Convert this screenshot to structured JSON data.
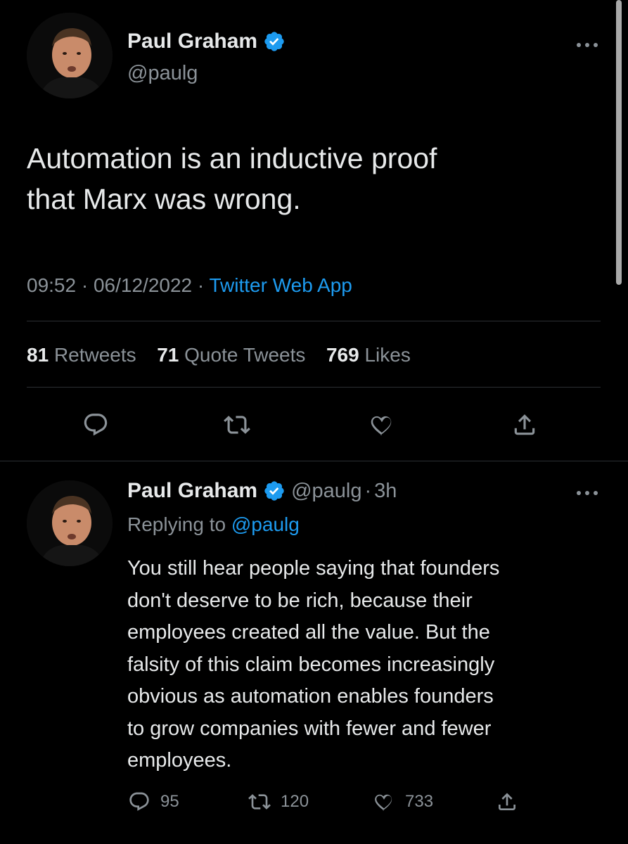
{
  "main_tweet": {
    "author_name": "Paul Graham",
    "handle": "@paulg",
    "text_line1": "Automation is an inductive proof",
    "text_line2": "that Marx was wrong.",
    "time": "09:52",
    "date": "06/12/2022",
    "source": "Twitter Web App",
    "stats": {
      "retweets_count": "81",
      "retweets_label": "Retweets",
      "quotes_count": "71",
      "quotes_label": "Quote Tweets",
      "likes_count": "769",
      "likes_label": "Likes"
    }
  },
  "reply_tweet": {
    "author_name": "Paul Graham",
    "handle": "@paulg",
    "age": "3h",
    "replying_prefix": "Replying to",
    "replying_handle": "@paulg",
    "lines": [
      "You still hear people saying that founders",
      "don't deserve to be rich, because their",
      "employees created all the value. But the",
      "falsity of this claim becomes increasingly",
      "obvious as automation enables founders",
      "to grow companies with fewer and fewer",
      "employees."
    ],
    "reply_count": "95",
    "retweet_count": "120",
    "like_count": "733"
  },
  "icons": {
    "verified": "verified-badge-icon",
    "more": "more-horizontal-icon",
    "reply": "reply-bubble-icon",
    "retweet": "retweet-arrows-icon",
    "like": "heart-icon",
    "share": "share-upload-icon"
  },
  "colors": {
    "background": "#000000",
    "text_primary": "#e7e9ea",
    "text_secondary": "#8b9298",
    "accent": "#1d9bf0",
    "divider": "#2b2f33"
  }
}
